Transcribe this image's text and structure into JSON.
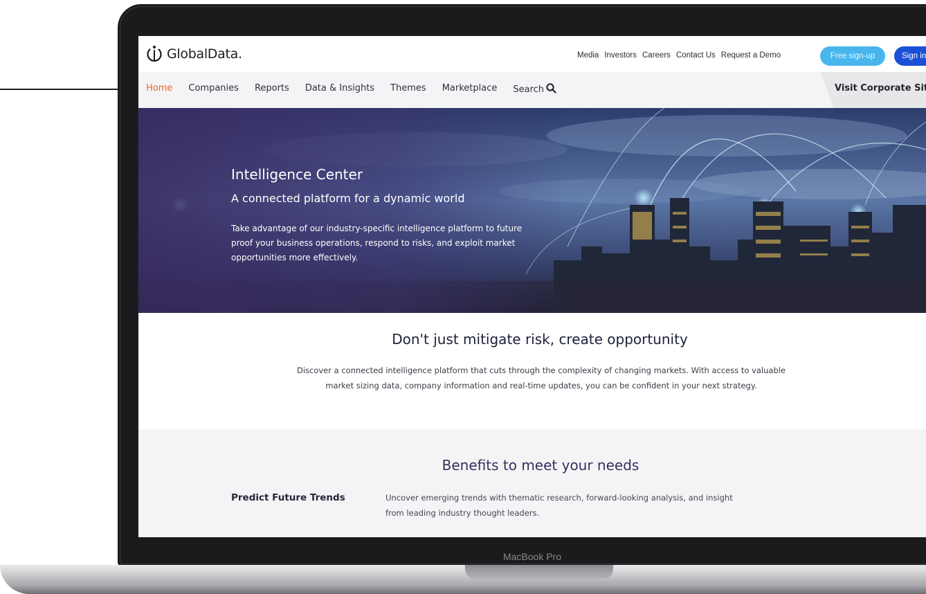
{
  "topbar": {
    "logo_text": "GlobalData.",
    "utility_links": [
      "Media",
      "Investors",
      "Careers",
      "Contact Us",
      "Request a Demo"
    ],
    "free_signup_label": "Free sign-up",
    "signin_label": "Sign in"
  },
  "nav": {
    "items": [
      {
        "label": "Home",
        "active": true
      },
      {
        "label": "Companies",
        "active": false
      },
      {
        "label": "Reports",
        "active": false
      },
      {
        "label": "Data & Insights",
        "active": false
      },
      {
        "label": "Themes",
        "active": false
      },
      {
        "label": "Marketplace",
        "active": false
      }
    ],
    "search_label": "Search",
    "corporate_site_label": "Visit Corporate Site"
  },
  "hero": {
    "title": "Intelligence Center",
    "subtitle": "A connected platform for a dynamic world",
    "body": "Take advantage of our industry-specific intelligence platform to future proof your business operations, respond to risks, and exploit market opportunities more effectively."
  },
  "section_opportunity": {
    "title": "Don't just mitigate risk, create opportunity",
    "body": "Discover a connected intelligence platform that cuts through the complexity of changing markets. With access to valuable market sizing data, company information and real-time updates, you can be confident in your next strategy."
  },
  "section_benefits": {
    "title": "Benefits to meet your needs",
    "items": [
      {
        "title": "Predict Future Trends",
        "description": "Uncover emerging trends with thematic research, forward-looking analysis, and insight from leading industry thought leaders."
      }
    ]
  },
  "device": {
    "label": "MacBook Pro"
  },
  "colors": {
    "nav_active": "#f0622a",
    "signup_button": "#48b6ec",
    "signin_button": "#1b50d6",
    "heading": "#1d1f3a"
  },
  "icons": {
    "logo": "globaldata-logo-icon",
    "search": "search-icon"
  }
}
